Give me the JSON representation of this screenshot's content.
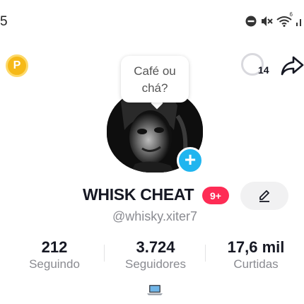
{
  "status_bar": {
    "time": "5",
    "icons": [
      "do-not-disturb-icon",
      "mute-icon",
      "wifi-icon",
      "signal-icon"
    ],
    "wifi_label": "6"
  },
  "header": {
    "coin_label": "P",
    "visitors_count": "14",
    "share_icon": "share-icon"
  },
  "note": {
    "text_line1": "Café ou",
    "text_line2": "chá?"
  },
  "profile": {
    "display_name": "WHISK CHEAT",
    "notification_badge": "9+",
    "username": "@whisky.xiter7",
    "edit_icon": "pencil-icon",
    "add_icon": "plus-icon"
  },
  "stats": [
    {
      "value": "212",
      "label": "Seguindo"
    },
    {
      "value": "3.724",
      "label": "Seguidores"
    },
    {
      "value": "17,6 mil",
      "label": "Curtidas"
    }
  ],
  "bio_icon": "laptop-icon",
  "colors": {
    "accent_red": "#fe2c55",
    "add_blue": "#20b5ef",
    "coin_gold": "#f6b918",
    "muted_text": "#8a8b91"
  }
}
